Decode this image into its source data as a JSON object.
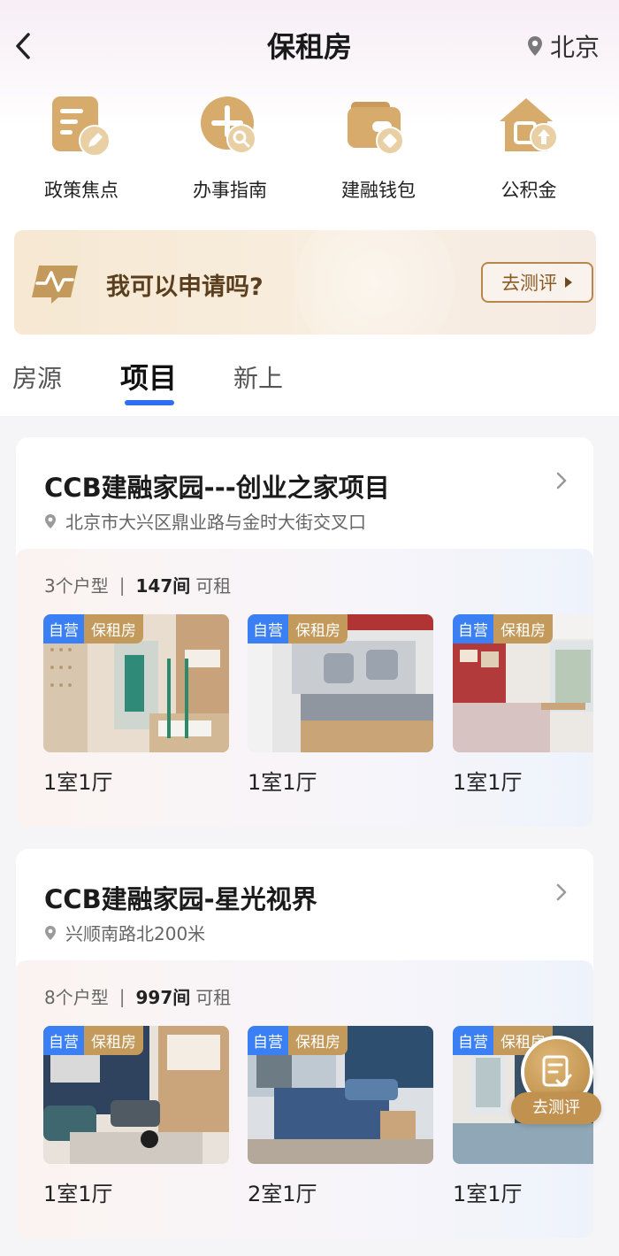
{
  "header": {
    "title": "保租房",
    "city": "北京"
  },
  "quick_links": [
    {
      "label": "政策焦点",
      "icon": "policy-document-icon"
    },
    {
      "label": "办事指南",
      "icon": "guide-search-icon"
    },
    {
      "label": "建融钱包",
      "icon": "wallet-icon"
    },
    {
      "label": "公积金",
      "icon": "housing-fund-icon"
    }
  ],
  "banner": {
    "text": "我可以申请吗?",
    "button": "去测评"
  },
  "tabs": [
    {
      "label": "房源"
    },
    {
      "label": "项目",
      "active": true
    },
    {
      "label": "新上"
    }
  ],
  "projects": [
    {
      "title": "CCB建融家园---创业之家项目",
      "address": "北京市大兴区鼎业路与金时大街交叉口",
      "layouts": "3个户型",
      "rooms_count": "147间",
      "rooms_suffix": "可租",
      "listings": [
        {
          "badge_self": "自营",
          "badge_type": "保租房",
          "room_type": "1室1厅"
        },
        {
          "badge_self": "自营",
          "badge_type": "保租房",
          "room_type": "1室1厅"
        },
        {
          "badge_self": "自营",
          "badge_type": "保租房",
          "room_type": "1室1厅"
        }
      ]
    },
    {
      "title": "CCB建融家园-星光视界",
      "address": "兴顺南路北200米",
      "layouts": "8个户型",
      "rooms_count": "997间",
      "rooms_suffix": "可租",
      "listings": [
        {
          "badge_self": "自营",
          "badge_type": "保租房",
          "room_type": "1室1厅"
        },
        {
          "badge_self": "自营",
          "badge_type": "保租房",
          "room_type": "2室1厅"
        },
        {
          "badge_self": "自营",
          "badge_type": "保租房",
          "room_type": "1室1厅"
        }
      ]
    }
  ],
  "floating": {
    "label": "去测评"
  },
  "colors": {
    "accent_blue": "#2d6ff0",
    "gold": "#c39a5b",
    "brown_text": "#5a3e1e"
  }
}
